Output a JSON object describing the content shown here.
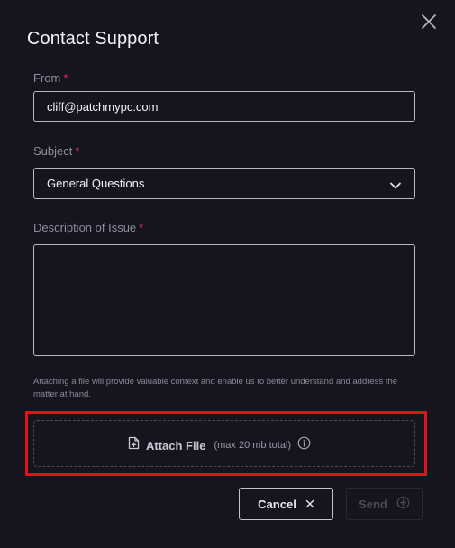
{
  "dialog": {
    "title": "Contact Support",
    "close_icon": "close-icon"
  },
  "form": {
    "from": {
      "label": "From",
      "required_mark": "*",
      "value": "cliff@patchmypc.com"
    },
    "subject": {
      "label": "Subject",
      "required_mark": "*",
      "selected": "General Questions",
      "icon": "chevron-down-icon"
    },
    "description": {
      "label": "Description of Issue",
      "required_mark": "*",
      "value": ""
    },
    "hint": "Attaching a file will provide valuable context and enable us to better understand and address the matter at hand.",
    "attach": {
      "label": "Attach File",
      "size_note": "(max 20 mb total)",
      "file_icon": "file-plus-icon",
      "info_icon": "info-icon"
    }
  },
  "actions": {
    "cancel_label": "Cancel",
    "cancel_icon": "x-icon",
    "send_label": "Send",
    "send_icon": "plus-circle-icon"
  },
  "colors": {
    "background": "#15151f",
    "required": "#e0306a",
    "highlight": "#e3121a",
    "input_border": "#b9b9c4"
  }
}
